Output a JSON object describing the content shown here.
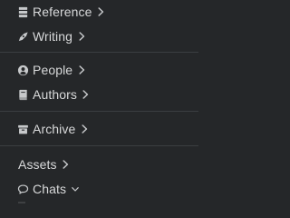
{
  "sidebar": {
    "items": [
      {
        "label": "Reference",
        "icon": "book-stack-icon",
        "chevron": "right"
      },
      {
        "label": "Writing",
        "icon": "pen-nib-icon",
        "chevron": "right"
      },
      {
        "label": "People",
        "icon": "user-circle-icon",
        "chevron": "right"
      },
      {
        "label": "Authors",
        "icon": "book-icon",
        "chevron": "right"
      },
      {
        "label": "Archive",
        "icon": "archive-box-icon",
        "chevron": "right"
      },
      {
        "label": "Assets",
        "icon": "",
        "chevron": "right"
      },
      {
        "label": "Chats",
        "icon": "chat-bubble-icon",
        "chevron": "down"
      }
    ]
  },
  "colors": {
    "background": "#252729",
    "divider": "#3b3e41",
    "text": "#d8d9da",
    "icon": "#c7c9cb"
  }
}
